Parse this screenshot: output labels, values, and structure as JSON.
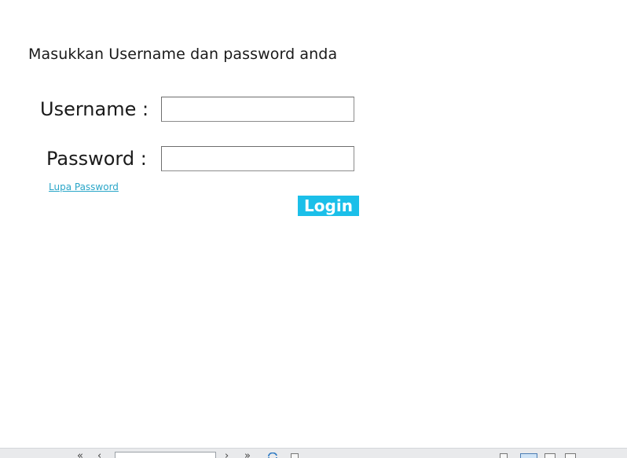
{
  "login": {
    "instruction": "Masukkan Username dan password anda",
    "username_label": "Username :",
    "username_value": "",
    "password_label": "Password :",
    "password_value": "",
    "forgot_link": "Lupa Password",
    "login_button": "Login"
  },
  "toolbar": {
    "first_icon": "first-page-icon",
    "prev_icon": "previous-page-icon",
    "next_icon": "next-page-icon",
    "last_icon": "last-page-icon",
    "refresh_icon": "refresh-icon",
    "colors": {
      "link": "#2aa6c8",
      "button": "#1bbfe9"
    }
  }
}
